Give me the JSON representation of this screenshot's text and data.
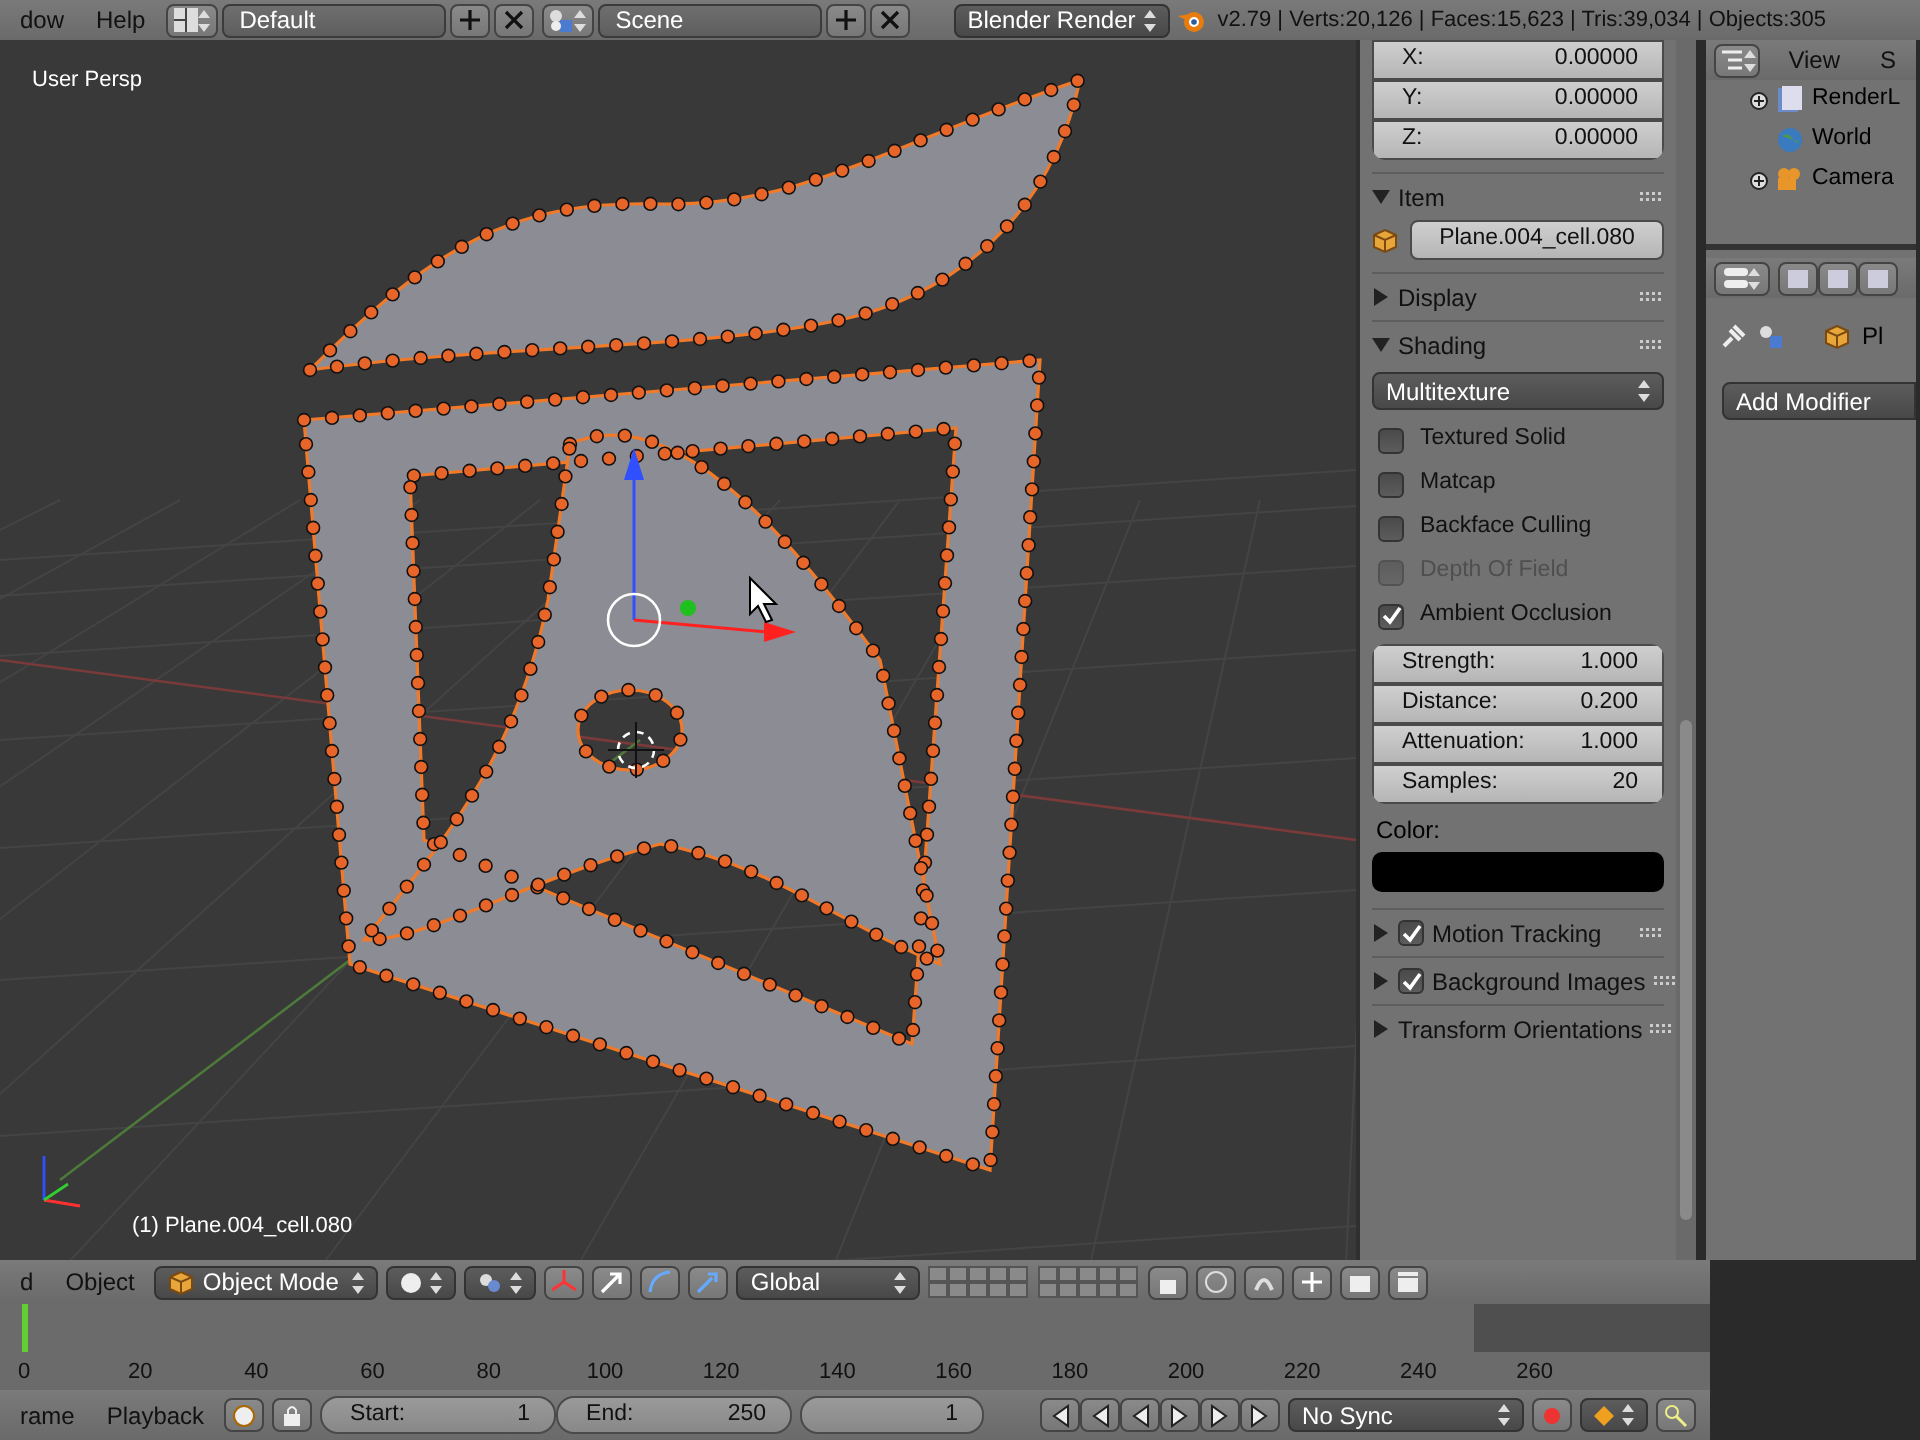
{
  "top_bar": {
    "menus": [
      "dow",
      "Help"
    ],
    "screen_layout": "Default",
    "scene": "Scene",
    "render_engine": "Blender Render",
    "stats": "v2.79 | Verts:20,126 | Faces:15,623 | Tris:39,034 | Objects:305"
  },
  "viewport": {
    "view_name": "User Persp",
    "active_object": "(1) Plane.004_cell.080"
  },
  "n_panel": {
    "location": [
      {
        "label": "X:",
        "value": "0.00000"
      },
      {
        "label": "Y:",
        "value": "0.00000"
      },
      {
        "label": "Z:",
        "value": "0.00000"
      }
    ],
    "panels": [
      {
        "kind": "item",
        "title": "Item",
        "expanded": true,
        "object_name": "Plane.004_cell.080"
      },
      {
        "kind": "plain",
        "title": "Display",
        "expanded": false
      },
      {
        "kind": "shading",
        "title": "Shading",
        "expanded": true,
        "mode": "Multitexture",
        "options": [
          {
            "label": "Textured Solid",
            "checked": false,
            "disabled": false
          },
          {
            "label": "Matcap",
            "checked": false,
            "disabled": false
          },
          {
            "label": "Backface Culling",
            "checked": false,
            "disabled": false
          },
          {
            "label": "Depth Of Field",
            "checked": false,
            "disabled": true
          },
          {
            "label": "Ambient Occlusion",
            "checked": true,
            "disabled": false
          }
        ],
        "ao_fields": [
          {
            "label": "Strength:",
            "value": "1.000"
          },
          {
            "label": "Distance:",
            "value": "0.200"
          },
          {
            "label": "Attenuation:",
            "value": "1.000"
          },
          {
            "label": "Samples:",
            "value": "20"
          }
        ],
        "color_label": "Color:"
      },
      {
        "kind": "toggle",
        "title": "Motion Tracking",
        "expanded": false,
        "checked": true
      },
      {
        "kind": "toggle",
        "title": "Background Images",
        "expanded": false,
        "checked": true
      },
      {
        "kind": "plain",
        "title": "Transform Orientations",
        "expanded": false
      }
    ]
  },
  "outliner": {
    "menus": [
      "View",
      "S"
    ],
    "items": [
      {
        "label": "RenderL",
        "expandable": true
      },
      {
        "label": "World",
        "expandable": false
      },
      {
        "label": "Camera",
        "expandable": true
      }
    ]
  },
  "properties": {
    "path_label": "Pl",
    "add_modifier": "Add Modifier"
  },
  "view3d_header": {
    "menus": [
      "d",
      "Object"
    ],
    "mode": "Object Mode",
    "orientation": "Global"
  },
  "timeline": {
    "ticks": [
      "0",
      "20",
      "40",
      "60",
      "80",
      "100",
      "120",
      "140",
      "160",
      "180",
      "200",
      "220",
      "240",
      "260"
    ]
  },
  "timeline_header": {
    "menus": [
      "rame",
      "Playback"
    ],
    "start_label": "Start:",
    "start": "1",
    "end_label": "End:",
    "end": "250",
    "current_frame": "1",
    "sync": "No Sync"
  }
}
